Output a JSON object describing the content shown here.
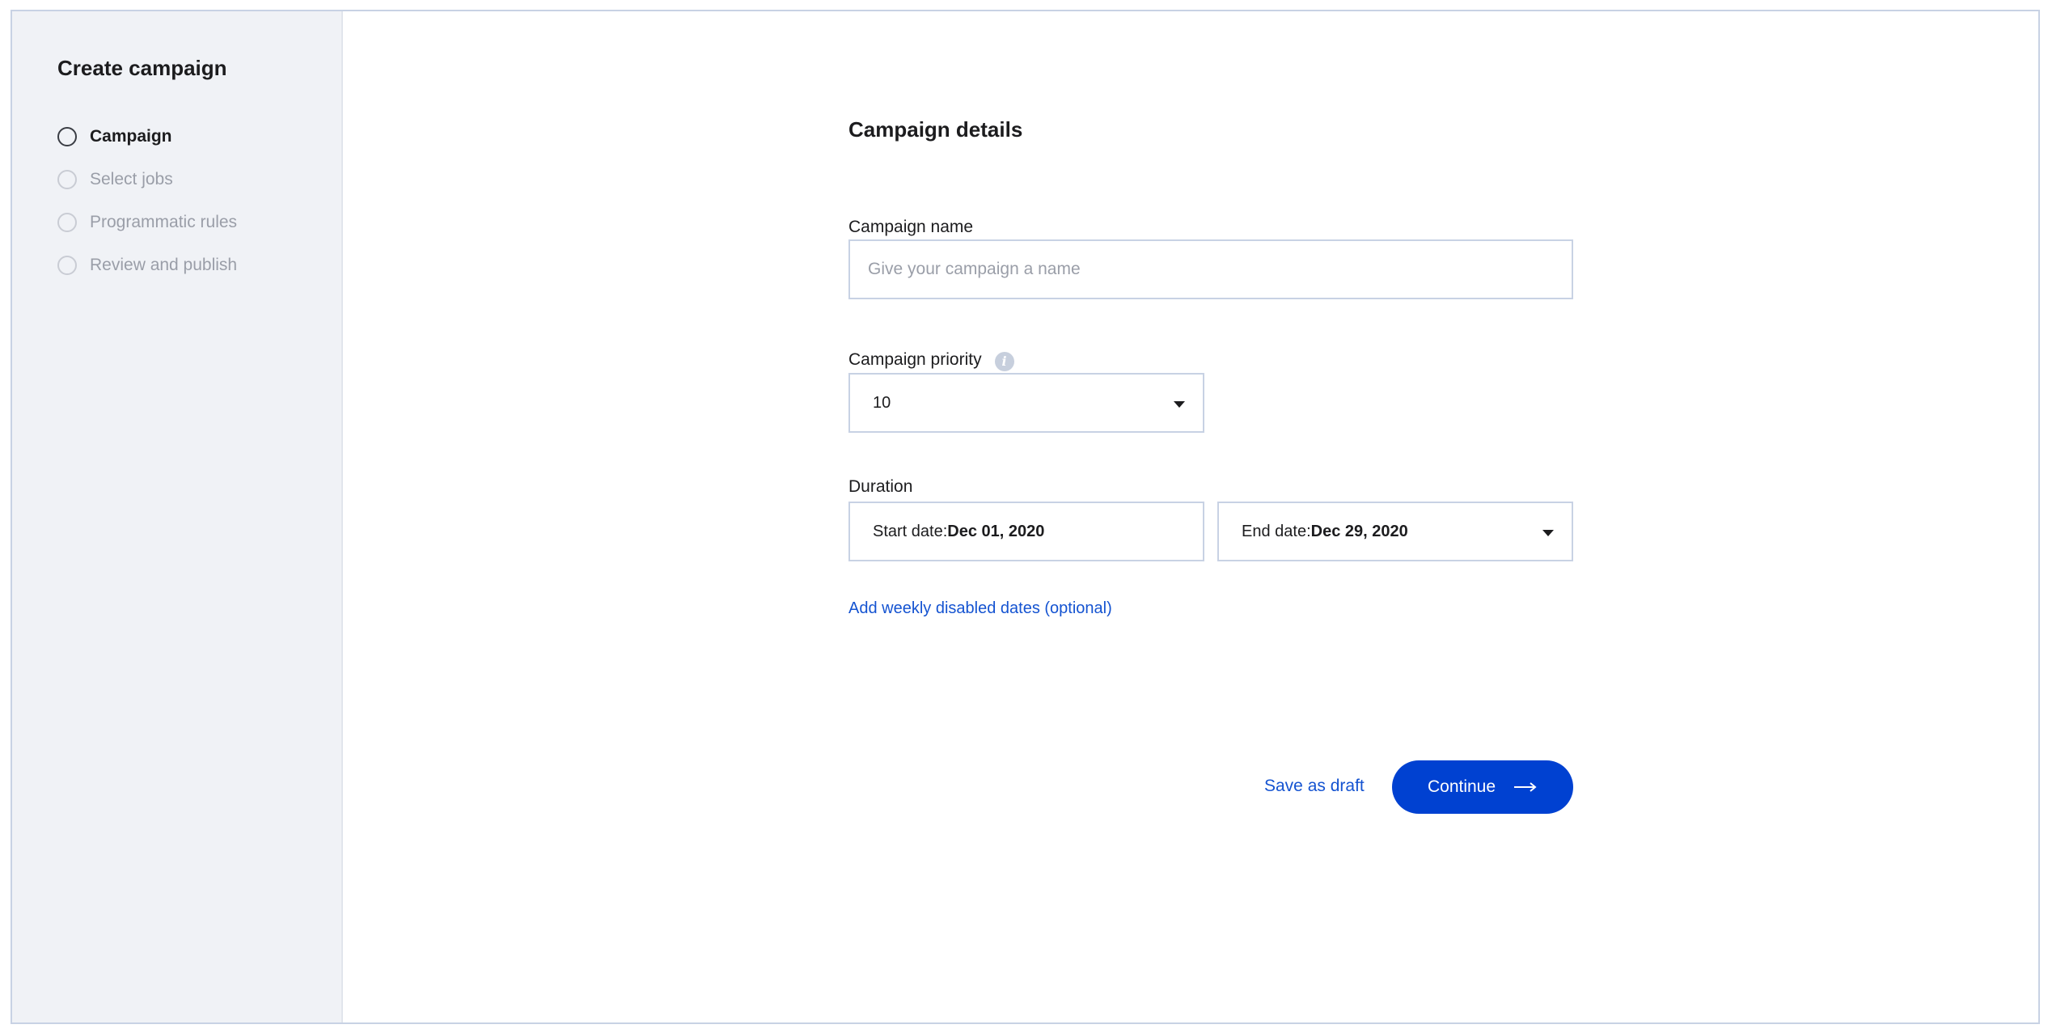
{
  "sidebar": {
    "title": "Create campaign",
    "steps": [
      {
        "label": "Campaign",
        "active": true
      },
      {
        "label": "Select jobs",
        "active": false
      },
      {
        "label": "Programmatic rules",
        "active": false
      },
      {
        "label": "Review and publish",
        "active": false
      }
    ]
  },
  "form": {
    "title": "Campaign details",
    "campaign_name": {
      "label": "Campaign name",
      "value": "",
      "placeholder": "Give your campaign a name"
    },
    "priority": {
      "label": "Campaign priority",
      "info_icon": "info-icon",
      "value": "10"
    },
    "duration": {
      "label": "Duration",
      "start_label": "Start date: ",
      "start_value": "Dec 01, 2020",
      "end_label": "End date: ",
      "end_value": "Dec 29, 2020"
    },
    "disabled_dates_link": "Add weekly disabled dates (optional)"
  },
  "actions": {
    "save_draft": "Save as draft",
    "continue": "Continue"
  },
  "colors": {
    "accent": "#0041d1",
    "link": "#1453d1",
    "sidebar_bg": "#f0f2f6",
    "border": "#c8d2e4"
  }
}
